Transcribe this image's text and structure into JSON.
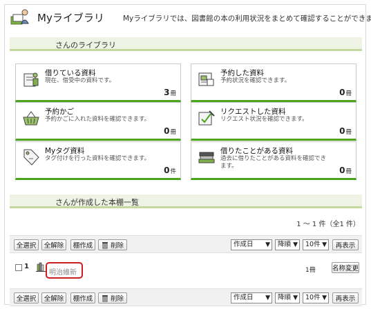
{
  "header": {
    "title": "Myライブラリ",
    "description": "Myライブラリでは、図書館の本の利用状況をまとめて確認することができます。"
  },
  "library_section": {
    "title": "さんのライブラリ"
  },
  "cards": [
    {
      "title": "借りている資料",
      "desc": "現在、借受中の資料です。",
      "count": "3",
      "unit": "冊",
      "icon": "book-reader-icon"
    },
    {
      "title": "予約した資料",
      "desc": "予約状況を確認できます。",
      "count": "0",
      "unit": "冊",
      "icon": "reservation-icon"
    },
    {
      "title": "予約かご",
      "desc": "予約かごに入れた資料を確認できます。",
      "count": "0",
      "unit": "冊",
      "icon": "basket-icon"
    },
    {
      "title": "リクエストした資料",
      "desc": "リクエスト状況を確認できます。",
      "count": "0",
      "unit": "冊",
      "icon": "request-icon"
    },
    {
      "title": "Myタグ資料",
      "desc": "タグ付けを行った資料を確認できます。",
      "count": "0",
      "unit": "件",
      "icon": "tag-icon"
    },
    {
      "title": "借りたことがある資料",
      "desc": "過去に借りたことがある資料を確認できます。",
      "count": "0",
      "unit": "冊",
      "icon": "history-books-icon"
    }
  ],
  "shelf_section": {
    "title": "さんが作成した本棚一覧"
  },
  "paging": "1 ～ 1 件（全1 件）",
  "toolbar": {
    "select_all": "全選択",
    "deselect_all": "全解除",
    "create_shelf": "棚作成",
    "delete": "削除",
    "sort_field": "作成日",
    "sort_order": "降順",
    "per_page": "10件",
    "redisplay": "再表示"
  },
  "shelves": [
    {
      "num": "1",
      "name": "明治維新",
      "count": "1冊",
      "rename": "名称変更"
    }
  ],
  "colors": {
    "accent_green": "#4aa51a",
    "section_bg": "#eef3e3",
    "highlight_red": "#c81e1e"
  }
}
